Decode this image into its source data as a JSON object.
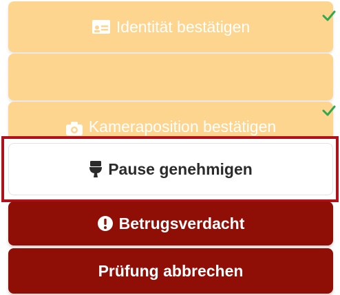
{
  "buttons": {
    "confirm_identity": {
      "label": "Identität bestätigen",
      "icon": "id-card-icon",
      "completed": true
    },
    "blank_step": {
      "label": ""
    },
    "confirm_camera": {
      "label": "Kameraposition bestätigen",
      "icon": "camera-icon",
      "completed": true
    },
    "approve_pause": {
      "label": "Pause genehmigen",
      "icon": "toilet-icon"
    },
    "fraud_suspicion": {
      "label": "Betrugsverdacht",
      "icon": "exclamation-circle-icon"
    },
    "cancel_exam": {
      "label": "Prüfung abbrechen"
    }
  },
  "colors": {
    "amber": "#fdd58e",
    "dark_red": "#8f0e05",
    "highlight_border": "#b0121b",
    "check_green": "#2fa84f"
  }
}
